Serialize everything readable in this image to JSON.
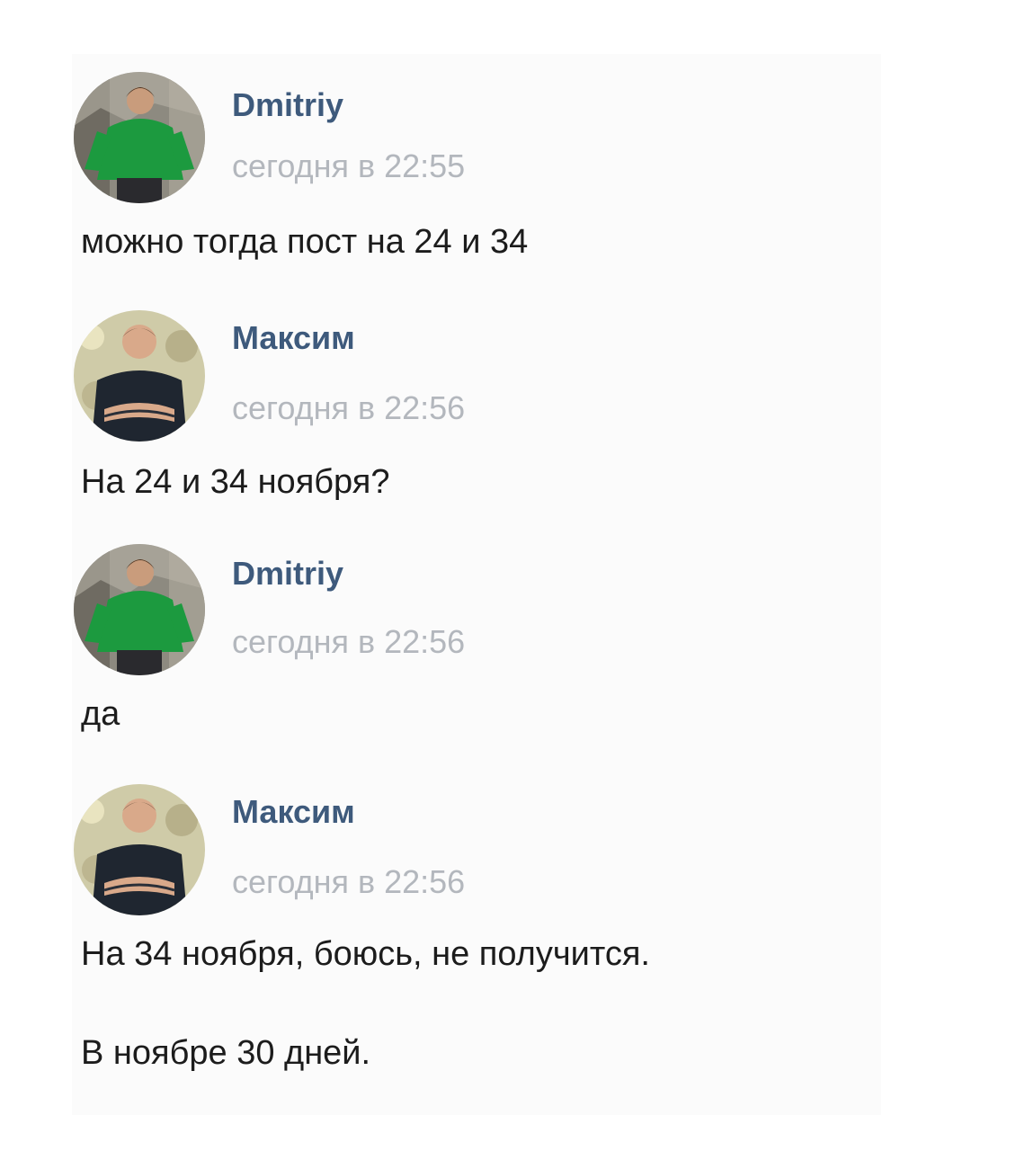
{
  "messages": [
    {
      "author": "Dmitriy",
      "time": "сегодня в 22:55",
      "avatar_icon": "user-photo-green-sweater",
      "lines": [
        "можно тогда пост на 24 и 34"
      ]
    },
    {
      "author": "Максим",
      "time": "сегодня в 22:56",
      "avatar_icon": "user-photo-dark-shirt",
      "lines": [
        "На 24 и 34 ноября?"
      ]
    },
    {
      "author": "Dmitriy",
      "time": "сегодня в 22:56",
      "avatar_icon": "user-photo-green-sweater",
      "lines": [
        "да"
      ]
    },
    {
      "author": "Максим",
      "time": "сегодня в 22:56",
      "avatar_icon": "user-photo-dark-shirt",
      "lines": [
        "На 34 ноября, боюсь, не получится.",
        "В ноябре 30 дней."
      ]
    }
  ],
  "colors": {
    "author": "#3e5a7c",
    "timestamp": "#b3b7bd",
    "text": "#1c1c1c",
    "background": "#fbfbfb"
  }
}
